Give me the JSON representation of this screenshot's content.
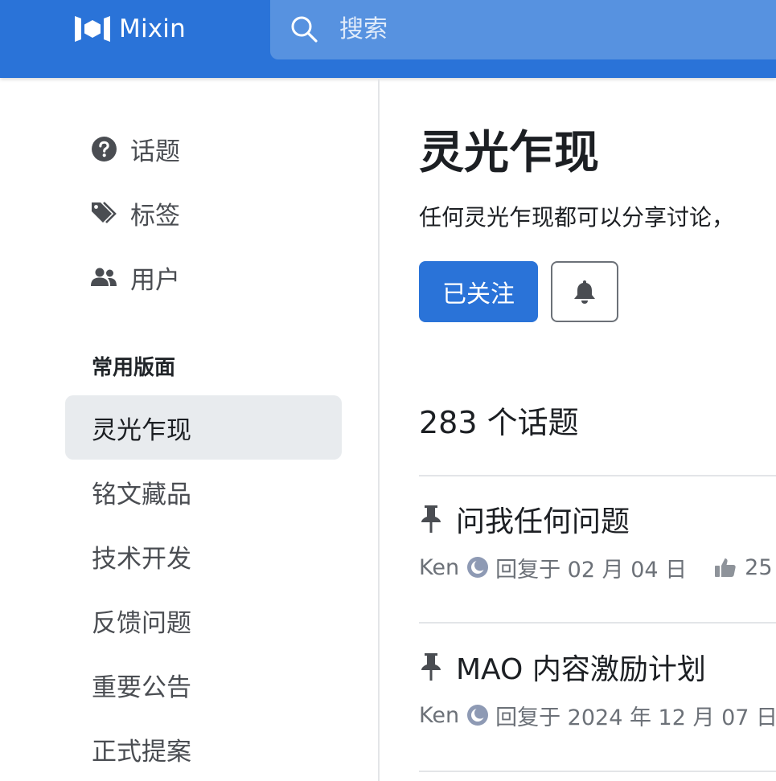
{
  "header": {
    "logo_text": "Mixin",
    "search": {
      "placeholder": "搜索"
    }
  },
  "sidebar": {
    "nav": [
      {
        "label": "话题",
        "icon": "question-circle-icon"
      },
      {
        "label": "标签",
        "icon": "tags-icon"
      },
      {
        "label": "用户",
        "icon": "users-icon"
      }
    ],
    "section_title": "常用版面",
    "categories": [
      {
        "label": "灵光乍现",
        "active": true
      },
      {
        "label": "铭文藏品"
      },
      {
        "label": "技术开发"
      },
      {
        "label": "反馈问题"
      },
      {
        "label": "重要公告"
      },
      {
        "label": "正式提案"
      }
    ]
  },
  "main": {
    "title": "灵光乍现",
    "description": "任何灵光乍现都可以分享讨论，",
    "follow_label": "已关注",
    "topic_count": "283 个话题",
    "topics": [
      {
        "title": "问我任何问题",
        "author": "Ken",
        "reply_text": "回复于 02 月 04 日",
        "likes": "25"
      },
      {
        "title": "MAO 内容激励计划",
        "author": "Ken",
        "reply_text": "回复于 2024 年 12 月 07 日"
      }
    ]
  },
  "colors": {
    "brand": "#2a73d8",
    "search_bg": "#5792e0",
    "active_bg": "#e8ebee",
    "muted_text": "#6c7178"
  }
}
